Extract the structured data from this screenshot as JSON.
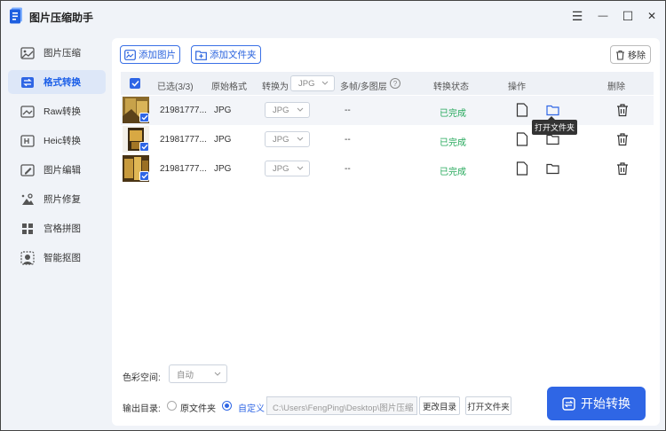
{
  "app": {
    "title": "图片压缩助手",
    "colors": {
      "accent": "#2f66e5",
      "success": "#24a85a"
    }
  },
  "window_controls": {
    "menu": "☰",
    "minimize": "—",
    "maximize": "☐",
    "close": "✕"
  },
  "sidebar": {
    "items": [
      {
        "label": "图片压缩",
        "icon": "image-compress-icon",
        "active": false
      },
      {
        "label": "格式转换",
        "icon": "convert-icon",
        "active": true
      },
      {
        "label": "Raw转换",
        "icon": "raw-icon",
        "active": false
      },
      {
        "label": "Heic转换",
        "icon": "heic-icon",
        "active": false
      },
      {
        "label": "图片编辑",
        "icon": "image-edit-icon",
        "active": false
      },
      {
        "label": "照片修复",
        "icon": "photo-repair-icon",
        "active": false
      },
      {
        "label": "宫格拼图",
        "icon": "grid-collage-icon",
        "active": false
      },
      {
        "label": "智能抠图",
        "icon": "smart-cutout-icon",
        "active": false
      }
    ]
  },
  "toolbar": {
    "add_image": "添加图片",
    "add_folder": "添加文件夹",
    "remove": "移除"
  },
  "table": {
    "headers": {
      "selected": "已选(3/3)",
      "original_format": "原始格式",
      "convert_to": "转换为",
      "convert_to_value": "JPG",
      "multi_frame": "多帧/多图层",
      "status": "转换状态",
      "action": "操作",
      "delete": "删除"
    },
    "rows": [
      {
        "name": "21981777...",
        "format": "JPG",
        "target": "JPG",
        "frames": "--",
        "status": "已完成"
      },
      {
        "name": "21981777...",
        "format": "JPG",
        "target": "JPG",
        "frames": "--",
        "status": "已完成"
      },
      {
        "name": "21981777...",
        "format": "JPG",
        "target": "JPG",
        "frames": "--",
        "status": "已完成"
      }
    ],
    "tooltip": "打开文件夹"
  },
  "bottom": {
    "color_space_label": "色彩空间:",
    "color_space_value": "自动",
    "output_label": "输出目录:",
    "option_original": "原文件夹",
    "option_custom": "自定义",
    "path_value": "C:\\Users\\FengPing\\Desktop\\图片压缩",
    "change_dir": "更改目录",
    "open_folder": "打开文件夹",
    "start": "开始转换"
  }
}
